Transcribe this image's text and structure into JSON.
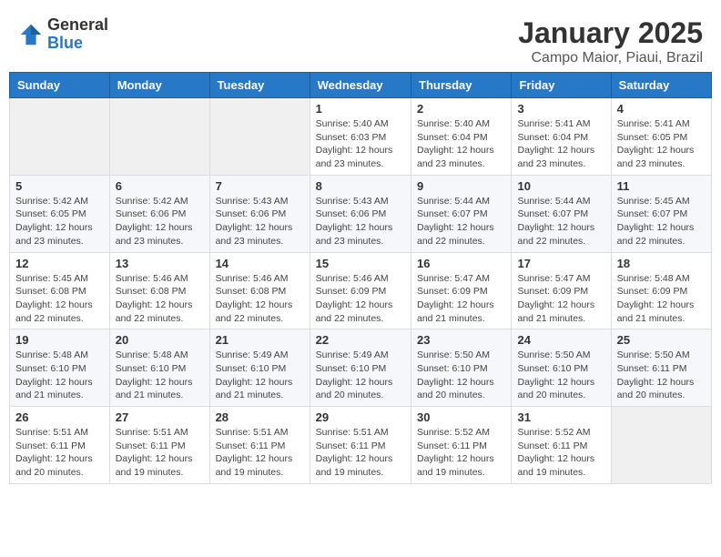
{
  "header": {
    "logo_general": "General",
    "logo_blue": "Blue",
    "month_title": "January 2025",
    "subtitle": "Campo Maior, Piaui, Brazil"
  },
  "days_of_week": [
    "Sunday",
    "Monday",
    "Tuesday",
    "Wednesday",
    "Thursday",
    "Friday",
    "Saturday"
  ],
  "weeks": [
    [
      {
        "day": "",
        "info": ""
      },
      {
        "day": "",
        "info": ""
      },
      {
        "day": "",
        "info": ""
      },
      {
        "day": "1",
        "info": "Sunrise: 5:40 AM\nSunset: 6:03 PM\nDaylight: 12 hours\nand 23 minutes."
      },
      {
        "day": "2",
        "info": "Sunrise: 5:40 AM\nSunset: 6:04 PM\nDaylight: 12 hours\nand 23 minutes."
      },
      {
        "day": "3",
        "info": "Sunrise: 5:41 AM\nSunset: 6:04 PM\nDaylight: 12 hours\nand 23 minutes."
      },
      {
        "day": "4",
        "info": "Sunrise: 5:41 AM\nSunset: 6:05 PM\nDaylight: 12 hours\nand 23 minutes."
      }
    ],
    [
      {
        "day": "5",
        "info": "Sunrise: 5:42 AM\nSunset: 6:05 PM\nDaylight: 12 hours\nand 23 minutes."
      },
      {
        "day": "6",
        "info": "Sunrise: 5:42 AM\nSunset: 6:06 PM\nDaylight: 12 hours\nand 23 minutes."
      },
      {
        "day": "7",
        "info": "Sunrise: 5:43 AM\nSunset: 6:06 PM\nDaylight: 12 hours\nand 23 minutes."
      },
      {
        "day": "8",
        "info": "Sunrise: 5:43 AM\nSunset: 6:06 PM\nDaylight: 12 hours\nand 23 minutes."
      },
      {
        "day": "9",
        "info": "Sunrise: 5:44 AM\nSunset: 6:07 PM\nDaylight: 12 hours\nand 22 minutes."
      },
      {
        "day": "10",
        "info": "Sunrise: 5:44 AM\nSunset: 6:07 PM\nDaylight: 12 hours\nand 22 minutes."
      },
      {
        "day": "11",
        "info": "Sunrise: 5:45 AM\nSunset: 6:07 PM\nDaylight: 12 hours\nand 22 minutes."
      }
    ],
    [
      {
        "day": "12",
        "info": "Sunrise: 5:45 AM\nSunset: 6:08 PM\nDaylight: 12 hours\nand 22 minutes."
      },
      {
        "day": "13",
        "info": "Sunrise: 5:46 AM\nSunset: 6:08 PM\nDaylight: 12 hours\nand 22 minutes."
      },
      {
        "day": "14",
        "info": "Sunrise: 5:46 AM\nSunset: 6:08 PM\nDaylight: 12 hours\nand 22 minutes."
      },
      {
        "day": "15",
        "info": "Sunrise: 5:46 AM\nSunset: 6:09 PM\nDaylight: 12 hours\nand 22 minutes."
      },
      {
        "day": "16",
        "info": "Sunrise: 5:47 AM\nSunset: 6:09 PM\nDaylight: 12 hours\nand 21 minutes."
      },
      {
        "day": "17",
        "info": "Sunrise: 5:47 AM\nSunset: 6:09 PM\nDaylight: 12 hours\nand 21 minutes."
      },
      {
        "day": "18",
        "info": "Sunrise: 5:48 AM\nSunset: 6:09 PM\nDaylight: 12 hours\nand 21 minutes."
      }
    ],
    [
      {
        "day": "19",
        "info": "Sunrise: 5:48 AM\nSunset: 6:10 PM\nDaylight: 12 hours\nand 21 minutes."
      },
      {
        "day": "20",
        "info": "Sunrise: 5:48 AM\nSunset: 6:10 PM\nDaylight: 12 hours\nand 21 minutes."
      },
      {
        "day": "21",
        "info": "Sunrise: 5:49 AM\nSunset: 6:10 PM\nDaylight: 12 hours\nand 21 minutes."
      },
      {
        "day": "22",
        "info": "Sunrise: 5:49 AM\nSunset: 6:10 PM\nDaylight: 12 hours\nand 20 minutes."
      },
      {
        "day": "23",
        "info": "Sunrise: 5:50 AM\nSunset: 6:10 PM\nDaylight: 12 hours\nand 20 minutes."
      },
      {
        "day": "24",
        "info": "Sunrise: 5:50 AM\nSunset: 6:10 PM\nDaylight: 12 hours\nand 20 minutes."
      },
      {
        "day": "25",
        "info": "Sunrise: 5:50 AM\nSunset: 6:11 PM\nDaylight: 12 hours\nand 20 minutes."
      }
    ],
    [
      {
        "day": "26",
        "info": "Sunrise: 5:51 AM\nSunset: 6:11 PM\nDaylight: 12 hours\nand 20 minutes."
      },
      {
        "day": "27",
        "info": "Sunrise: 5:51 AM\nSunset: 6:11 PM\nDaylight: 12 hours\nand 19 minutes."
      },
      {
        "day": "28",
        "info": "Sunrise: 5:51 AM\nSunset: 6:11 PM\nDaylight: 12 hours\nand 19 minutes."
      },
      {
        "day": "29",
        "info": "Sunrise: 5:51 AM\nSunset: 6:11 PM\nDaylight: 12 hours\nand 19 minutes."
      },
      {
        "day": "30",
        "info": "Sunrise: 5:52 AM\nSunset: 6:11 PM\nDaylight: 12 hours\nand 19 minutes."
      },
      {
        "day": "31",
        "info": "Sunrise: 5:52 AM\nSunset: 6:11 PM\nDaylight: 12 hours\nand 19 minutes."
      },
      {
        "day": "",
        "info": ""
      }
    ]
  ]
}
